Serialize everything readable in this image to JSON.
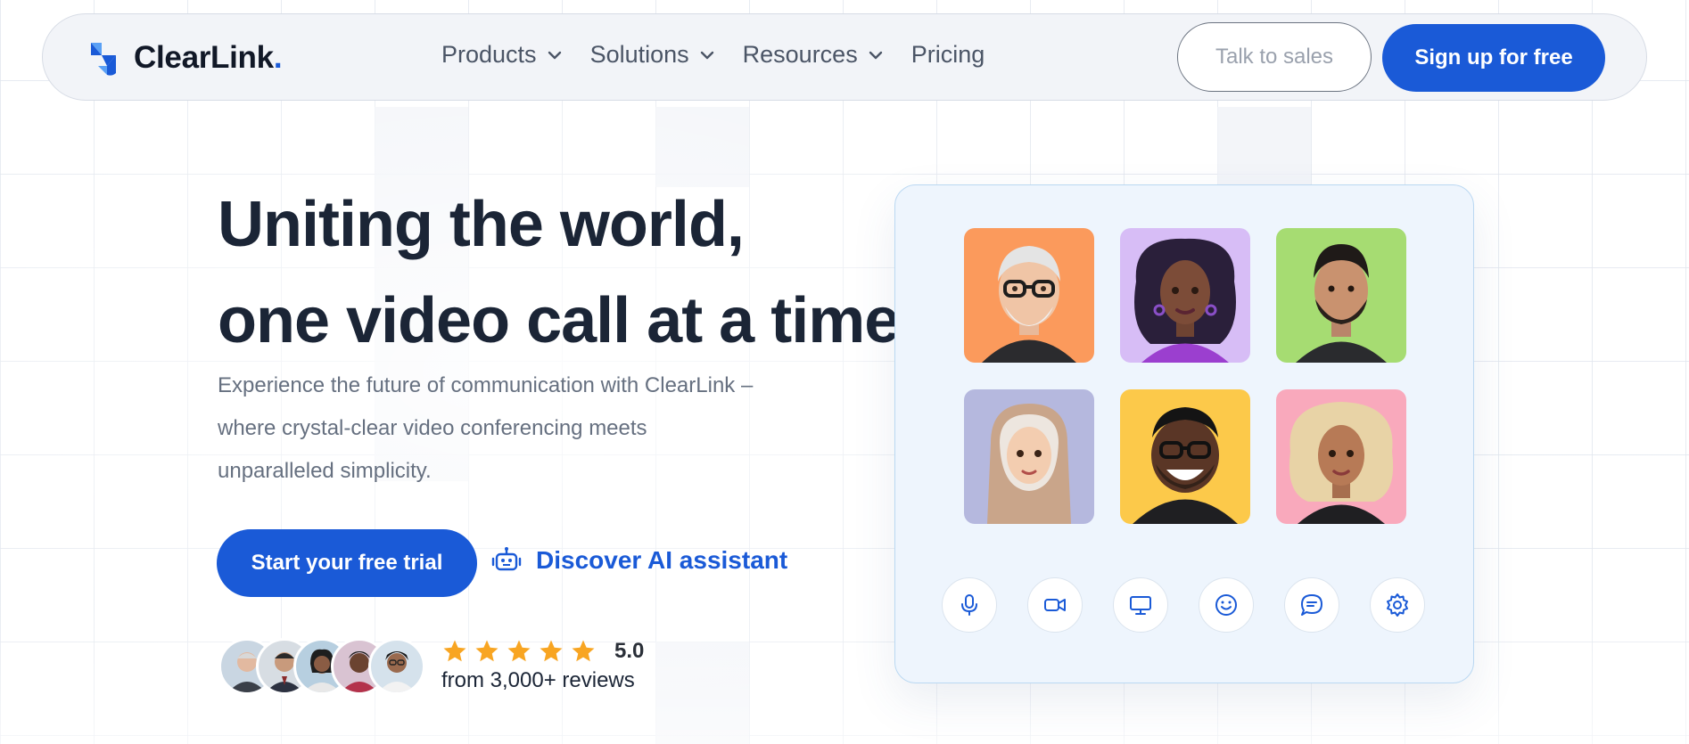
{
  "brand": {
    "name": "ClearLink",
    "dot": ".",
    "accent": "#1a5ad7"
  },
  "nav": {
    "items": [
      {
        "label": "Products",
        "has_dropdown": true
      },
      {
        "label": "Solutions",
        "has_dropdown": true
      },
      {
        "label": "Resources",
        "has_dropdown": true
      },
      {
        "label": "Pricing",
        "has_dropdown": false
      }
    ],
    "talk_to_sales": "Talk to sales",
    "sign_up": "Sign up for free"
  },
  "hero": {
    "headline_line1": "Uniting the world,",
    "headline_line2": "one video call at a time",
    "subtext_line1": "Experience the future of communication with ClearLink –",
    "subtext_line2": "where crystal-clear video conferencing meets",
    "subtext_line3": "unparalleled simplicity.",
    "cta_primary": "Start your free trial",
    "cta_secondary": "Discover AI assistant"
  },
  "reviews": {
    "stars": 5,
    "rating": "5.0",
    "count_text": "from 3,000+ reviews"
  },
  "call": {
    "participants": [
      {
        "bg": "#fb9a5c",
        "desc": "older-man-glasses"
      },
      {
        "bg": "#d7bdf6",
        "desc": "woman-curly-hair"
      },
      {
        "bg": "#a6dc72",
        "desc": "man-beard"
      },
      {
        "bg": "#b5b8de",
        "desc": "woman-hijab"
      },
      {
        "bg": "#fcc94a",
        "desc": "man-glasses-smiling"
      },
      {
        "bg": "#f9a9bc",
        "desc": "woman-blonde-curls"
      }
    ],
    "controls": [
      "microphone-icon",
      "video-camera-icon",
      "screen-share-icon",
      "emoji-icon",
      "chat-icon",
      "settings-icon"
    ]
  }
}
